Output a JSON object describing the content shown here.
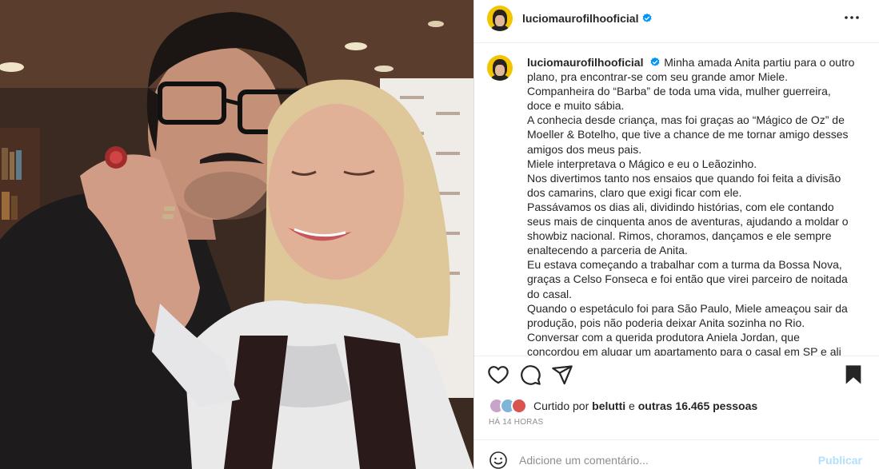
{
  "post": {
    "username": "luciomaurofilhooficial",
    "verified": true,
    "verified_icon": "verified-badge-icon",
    "more_icon": "more-horizontal-icon"
  },
  "caption": {
    "username": "luciomaurofilhooficial",
    "lines": [
      "Minha amada Anita partiu para o outro plano, pra encontrar-se com seu grande amor Miele.",
      "Companheira do “Barba” de toda uma vida, mulher guerreira, doce e muito sábia.",
      "A conhecia desde criança, mas foi graças ao “Mágico de Oz” de Moeller & Botelho, que tive a chance de me tornar amigo desses amigos dos meus pais.",
      "Miele interpretava o Mágico e eu o Leãozinho.",
      "Nos divertimos tanto nos ensaios que quando foi feita a divisão dos camarins, claro que exigi ficar com ele.",
      "Passávamos os dias ali, dividindo histórias, com ele contando seus mais de cinquenta anos de aventuras, ajudando a moldar o showbiz nacional. Rimos, choramos, dançamos e ele sempre enaltecendo a parceria de Anita.",
      "Eu estava começando a trabalhar com a turma da Bossa Nova, graças a Celso Fonseca e foi então que virei parceiro de noitada do casal.",
      "Quando o espetáculo foi para São Paulo, Miele ameaçou sair da produção, pois não poderia deixar Anita sozinha no Rio.",
      "Conversar com a querida produtora Aniela Jordan, que concordou em alugar um apartamento para o casal em SP e ali"
    ]
  },
  "actions": {
    "like_icon": "heart-icon",
    "comment_icon": "comment-icon",
    "share_icon": "send-icon",
    "save_icon": "bookmark-icon"
  },
  "likes": {
    "prefix": "Curtido por",
    "user": "belutti",
    "connector": "e",
    "others": "outras 16.465 pessoas",
    "avatar_colors": [
      "#c9a4c8",
      "#7fb5d6",
      "#d9534f"
    ]
  },
  "timestamp": "HÁ 14 HORAS",
  "comment_box": {
    "placeholder": "Adicione um comentário...",
    "post_label": "Publicar",
    "emoji_icon": "emoji-smiley-icon"
  },
  "colors": {
    "verified": "#0095f6",
    "post_button_disabled": "#b2dffc",
    "muted_text": "#8e8e8e"
  }
}
